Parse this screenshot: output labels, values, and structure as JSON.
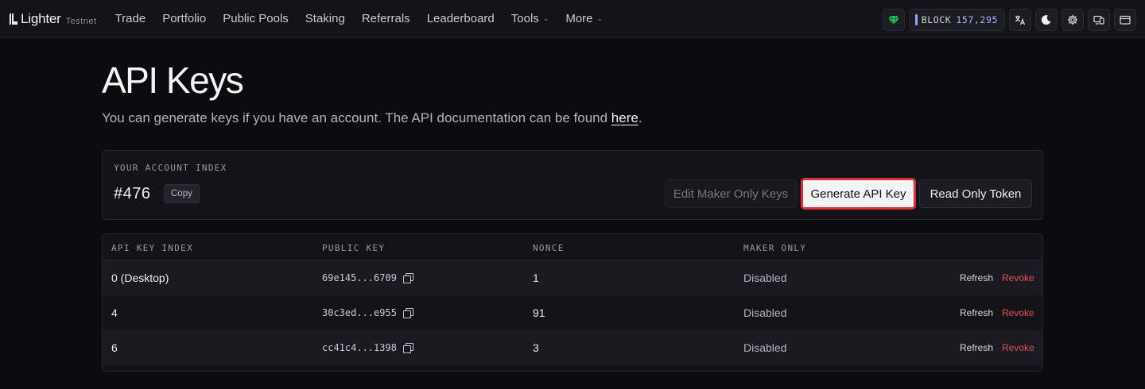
{
  "nav": {
    "brand": "Lighter",
    "env": "Testnet",
    "items": [
      {
        "label": "Trade"
      },
      {
        "label": "Portfolio"
      },
      {
        "label": "Public Pools"
      },
      {
        "label": "Staking"
      },
      {
        "label": "Referrals"
      },
      {
        "label": "Leaderboard"
      },
      {
        "label": "Tools",
        "dropdown": true
      },
      {
        "label": "More",
        "dropdown": true
      }
    ],
    "block_label": "BLOCK",
    "block_number": "157,295",
    "icons": [
      "gem-icon",
      "translate-icon",
      "moon-icon",
      "settings-icon",
      "devices-icon",
      "wallet-icon"
    ],
    "accent": "#22c55e"
  },
  "page": {
    "title": "API Keys",
    "subtitle_prefix": "You can generate keys if you have an account. The API documentation can be found ",
    "subtitle_link": "here",
    "subtitle_suffix": "."
  },
  "account": {
    "label": "YOUR ACCOUNT INDEX",
    "index": "#476",
    "copy_label": "Copy",
    "edit_label": "Edit Maker Only Keys",
    "generate_label": "Generate API Key",
    "read_only_label": "Read Only Token"
  },
  "table": {
    "headers": [
      "API KEY INDEX",
      "PUBLIC KEY",
      "NONCE",
      "MAKER ONLY"
    ],
    "rows": [
      {
        "index": "0 (Desktop)",
        "public_key": "69e145...6709",
        "nonce": "1",
        "maker_only": "Disabled"
      },
      {
        "index": "4",
        "public_key": "30c3ed...e955",
        "nonce": "91",
        "maker_only": "Disabled"
      },
      {
        "index": "6",
        "public_key": "cc41c4...1398",
        "nonce": "3",
        "maker_only": "Disabled"
      }
    ],
    "refresh_label": "Refresh",
    "revoke_label": "Revoke",
    "revoke_color": "#e2505c"
  }
}
